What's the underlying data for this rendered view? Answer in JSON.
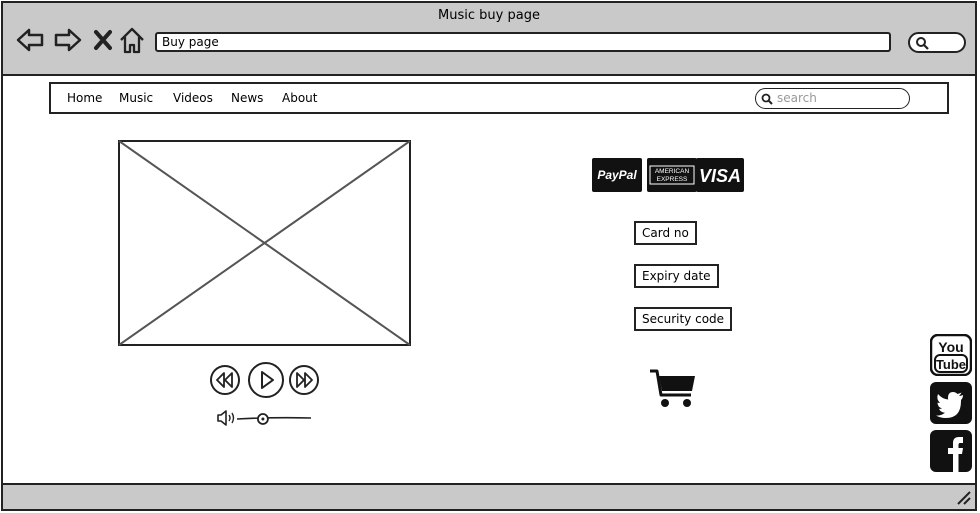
{
  "window": {
    "title": "Music buy page"
  },
  "browser": {
    "address": "Buy page",
    "nav_icons": [
      "back-arrow-icon",
      "forward-arrow-icon",
      "close-x-icon",
      "home-icon"
    ]
  },
  "menu": {
    "items": [
      {
        "label": "Home"
      },
      {
        "label": "Music"
      },
      {
        "label": "Videos"
      },
      {
        "label": "News"
      },
      {
        "label": "About"
      }
    ],
    "search_placeholder": "search"
  },
  "player": {
    "controls": [
      "rewind-icon",
      "play-icon",
      "fast-forward-icon"
    ],
    "volume_level": 0.35
  },
  "payment": {
    "brands": [
      "PayPal",
      "AMERICAN EXPRESS",
      "VISA"
    ],
    "fields": [
      {
        "label": "Card no"
      },
      {
        "label": "Expiry date"
      },
      {
        "label": "Security code"
      }
    ]
  },
  "social": {
    "youtube_line1": "You",
    "youtube_line2": "Tube",
    "icons": [
      "youtube-icon",
      "twitter-icon",
      "facebook-icon"
    ]
  },
  "colors": {
    "chrome": "#c9c9c9",
    "ink": "#222222"
  }
}
